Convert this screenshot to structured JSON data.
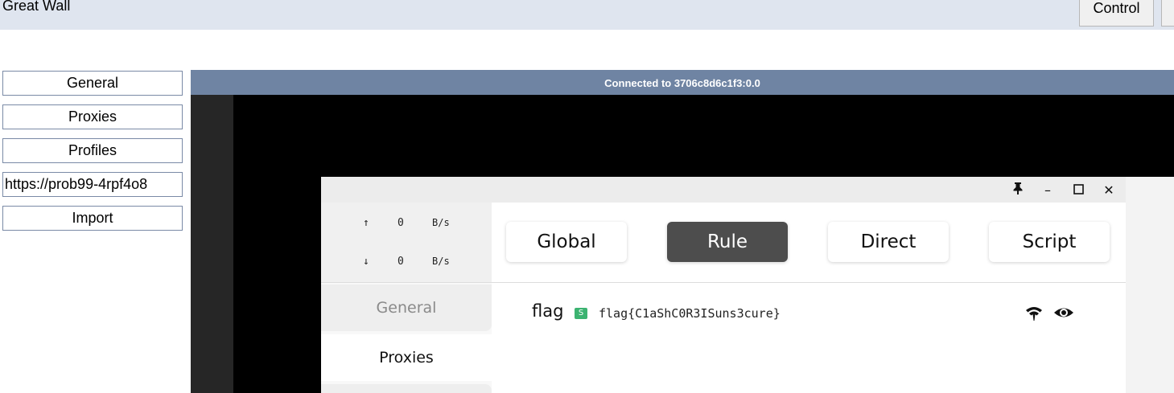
{
  "header": {
    "title": "Great Wall",
    "control_label": "Control"
  },
  "menu": {
    "items": [
      "General",
      "Proxies",
      "Profiles",
      "https://prob99-4rpf4o8",
      "Import"
    ]
  },
  "vnc": {
    "status": "Connected to 3706c8d6c1f3:0.0"
  },
  "clash": {
    "window_buttons": {
      "pin": "🖈",
      "minimize": "–",
      "maximize": "☐",
      "close": "✕"
    },
    "traffic": {
      "up_arrow": "↑",
      "up_value": "0",
      "up_unit": "B/s",
      "down_arrow": "↓",
      "down_value": "0",
      "down_unit": "B/s"
    },
    "nav": {
      "general": "General",
      "proxies": "Proxies"
    },
    "modes": {
      "global": "Global",
      "rule": "Rule",
      "direct": "Direct",
      "script": "Script",
      "active": "Rule"
    },
    "proxy": {
      "name": "flag",
      "badge": "S",
      "description": "flag{C1aShC0R3ISuns3cure}"
    }
  },
  "colors": {
    "topbar": "#dfe5ef",
    "vnc_status": "#6f84a3",
    "active_mode": "#4d4d4d",
    "badge": "#3cb371"
  }
}
